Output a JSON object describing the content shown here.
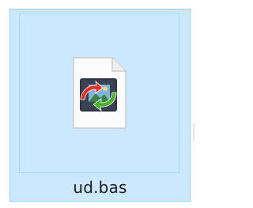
{
  "file": {
    "name": "ud.bas",
    "icon": "image-conversion-file-icon",
    "selected": true
  },
  "colors": {
    "selection_fill": "#cce8ff",
    "selection_border": "#99d1ff",
    "icon_dark": "#2f3440",
    "arrow_red": "#e0322c",
    "arrow_green": "#4caf2d"
  }
}
